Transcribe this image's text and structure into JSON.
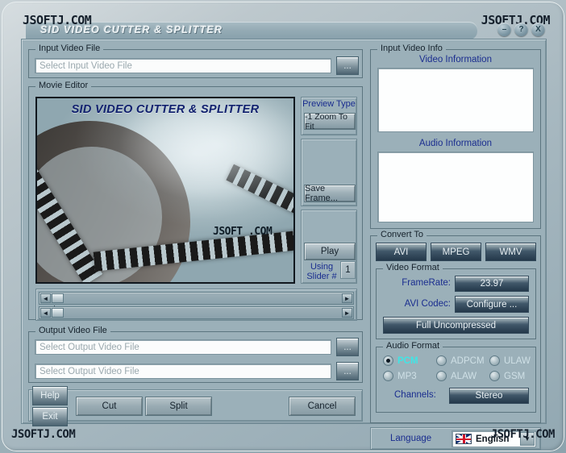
{
  "window": {
    "brand": "JSOFTJ.COM",
    "title": "SID  VIDEO CUTTER & SPLITTER",
    "buttons": {
      "minimize": "–",
      "help": "?",
      "close": "X"
    }
  },
  "input_video_file": {
    "group_label": "Input Video File",
    "placeholder": "Select Input Video File",
    "value": "",
    "browse_label": "..."
  },
  "movie_editor": {
    "group_label": "Movie Editor",
    "preview_title": "SID VIDEO CUTTER & SPLITTER",
    "preview_watermark": "JSOFT .COM",
    "preview_type_label": "Preview Type",
    "preview_type_value": "-1 Zoom To Fit",
    "save_frame_label": "Save Frame...",
    "play_label": "Play",
    "using_slider_label": "Using Slider #",
    "using_slider_value": "1",
    "scroll_left_glyph": "◄",
    "scroll_right_glyph": "►"
  },
  "input_video_info": {
    "group_label": "Input Video Info",
    "video_information_label": "Video Information",
    "video_information_value": "",
    "audio_information_label": "Audio Information",
    "audio_information_value": ""
  },
  "convert_to": {
    "group_label": "Convert To",
    "tabs": [
      {
        "label": "AVI",
        "selected": true
      },
      {
        "label": "MPEG",
        "selected": false
      },
      {
        "label": "WMV",
        "selected": false
      }
    ],
    "video_format": {
      "group_label": "Video Format",
      "framerate_label": "FrameRate:",
      "framerate_value": "23.97",
      "codec_label": "AVI Codec:",
      "configure_label": "Configure ...",
      "compression_label": "Full Uncompressed"
    },
    "audio_format": {
      "group_label": "Audio Format",
      "options": [
        {
          "label": "PCM",
          "selected": true
        },
        {
          "label": "ADPCM",
          "selected": false
        },
        {
          "label": "ULAW",
          "selected": false
        },
        {
          "label": "MP3",
          "selected": false
        },
        {
          "label": "ALAW",
          "selected": false
        },
        {
          "label": "GSM",
          "selected": false
        }
      ],
      "channels_label": "Channels:",
      "channels_value": "Stereo"
    }
  },
  "output_video_file": {
    "group_label": "Output Video File",
    "fields": [
      {
        "placeholder": "Select Output Video File",
        "value": "",
        "browse_label": "..."
      },
      {
        "placeholder": "Select Output Video File",
        "value": "",
        "browse_label": "..."
      }
    ]
  },
  "actions": {
    "help_label": "Help",
    "exit_label": "Exit",
    "cut_label": "Cut",
    "split_label": "Split",
    "cancel_label": "Cancel"
  },
  "language": {
    "label": "Language",
    "selected": "English",
    "dropdown_glyph": "▼"
  },
  "colors": {
    "background": "#9bb0b9",
    "accent_blue": "#1a2d8f",
    "selected_audio": "#3fe6e6",
    "frame": "#5c757f"
  }
}
